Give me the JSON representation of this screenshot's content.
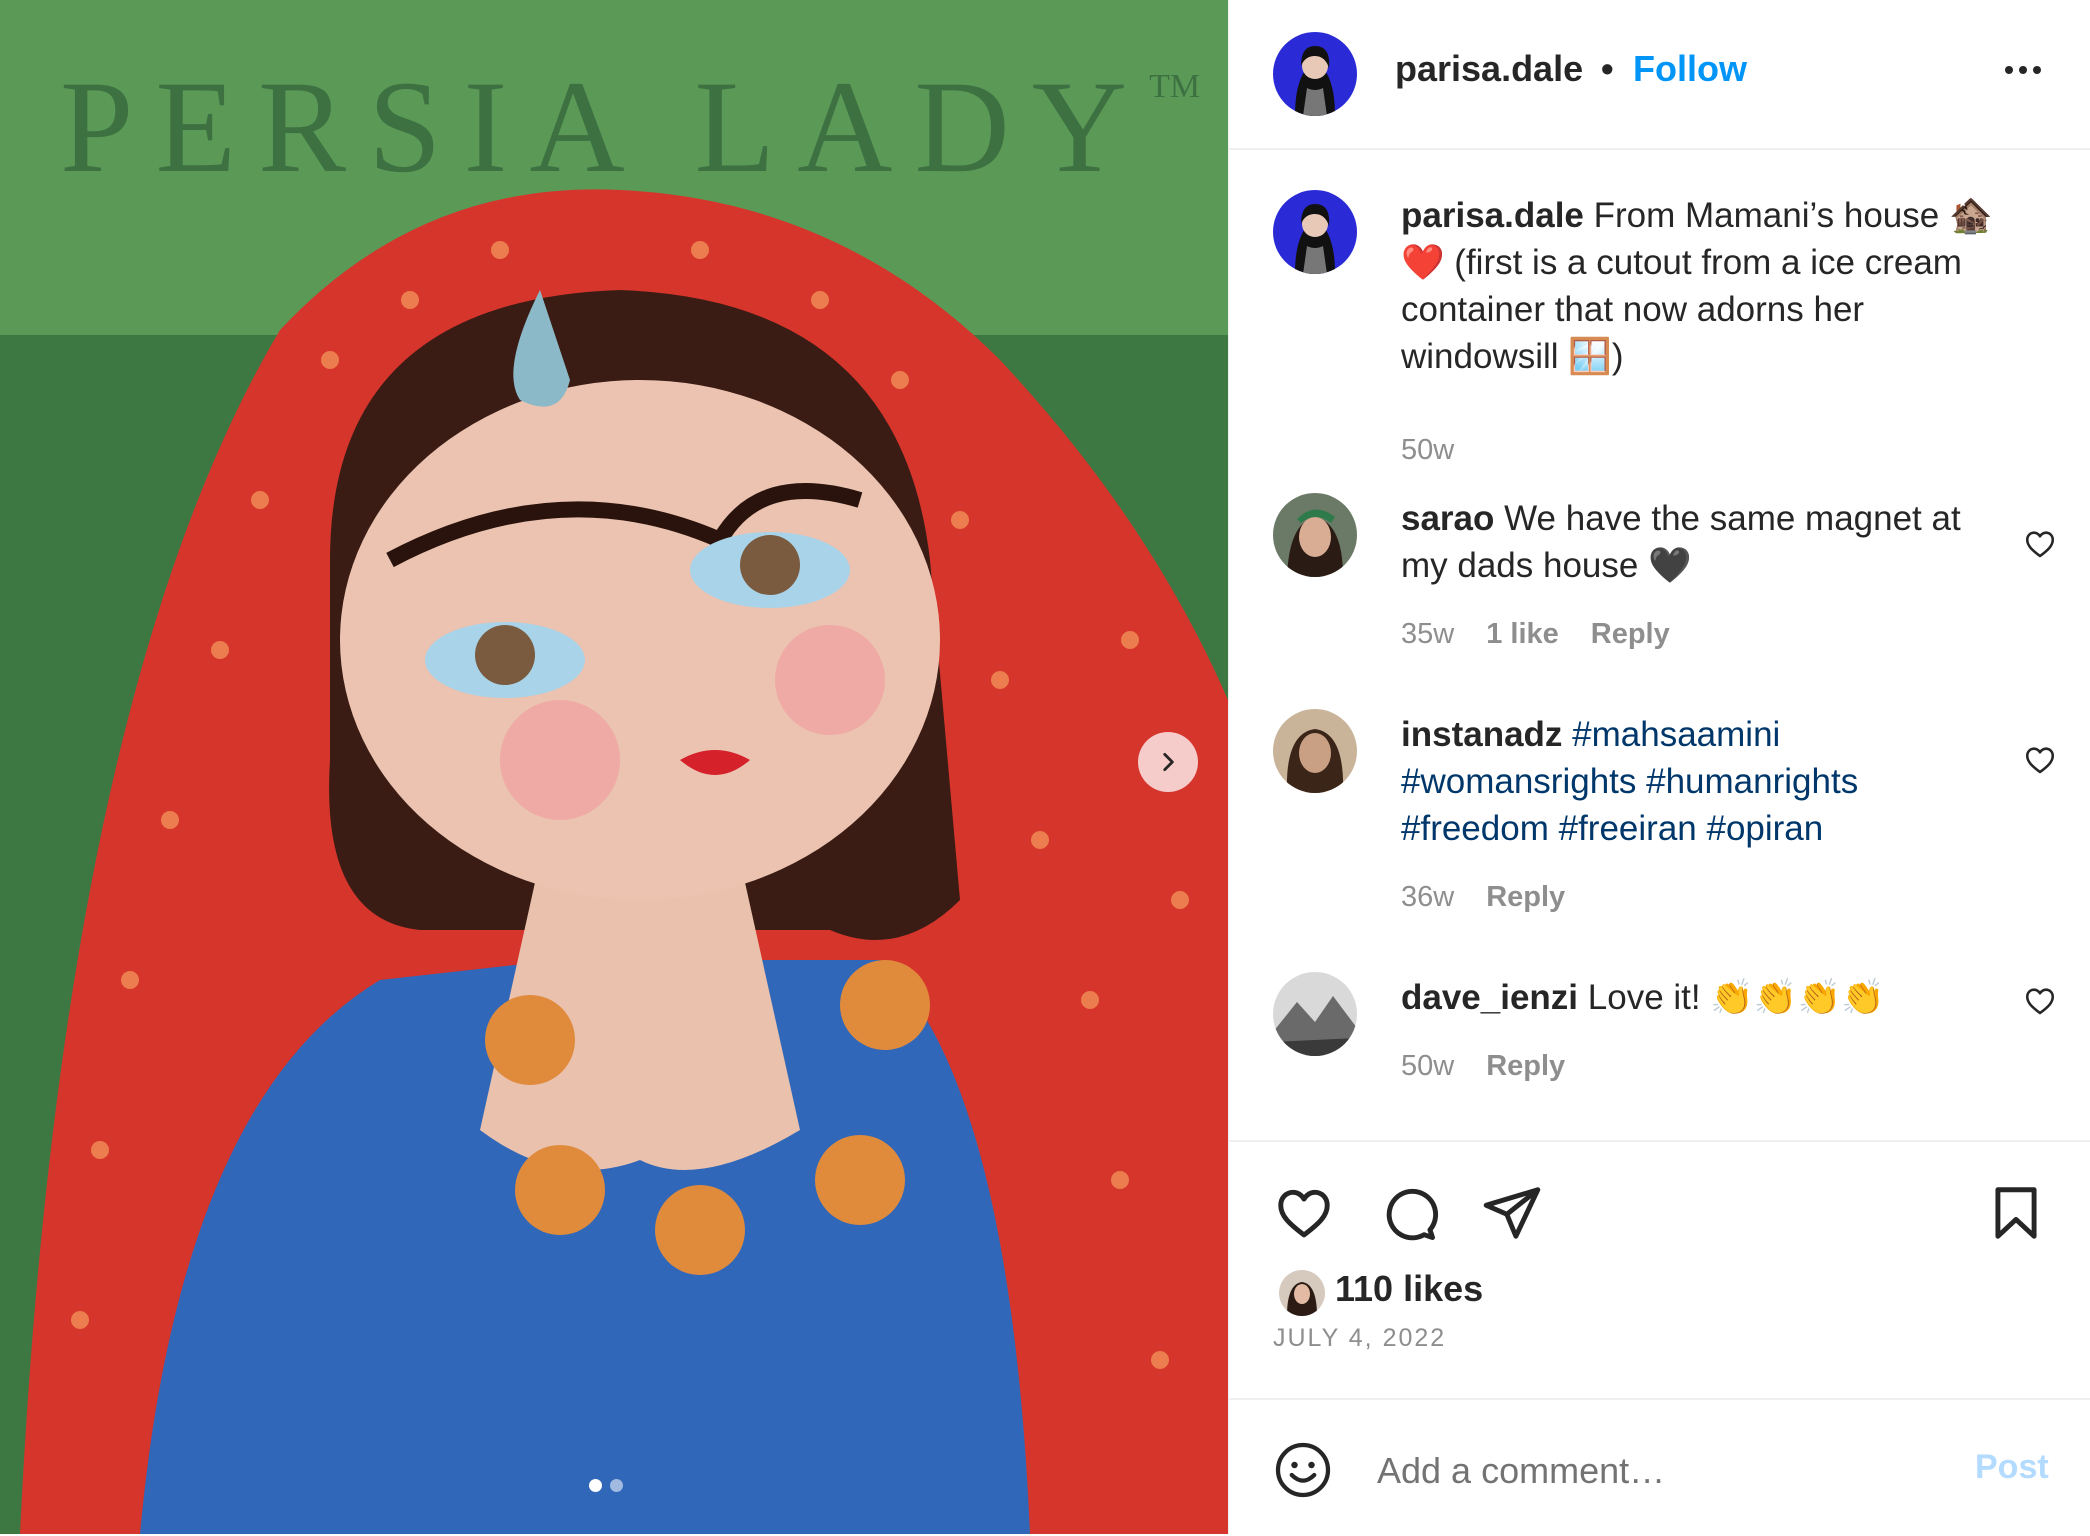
{
  "media": {
    "brand_text": "PERSIA LADY",
    "brand_mark": "TM",
    "carousel_dots": 2,
    "active_dot": 0
  },
  "header": {
    "username": "parisa.dale",
    "separator": "•",
    "follow_label": "Follow",
    "more_icon": "more-horizontal-icon"
  },
  "caption": {
    "username": "parisa.dale",
    "text": "From Mamani’s house 🏚️❤️ (first is a cutout from a ice cream container that now adorns her windowsill 🪟)",
    "age": "50w"
  },
  "comments": [
    {
      "username": "sarao",
      "text": "We have the same magnet at my dads house 🖤",
      "age": "35w",
      "likes": "1 like",
      "reply": "Reply"
    },
    {
      "username": "instanadz",
      "hashtags": [
        "#mahsaamini",
        "#womansrights",
        "#humanrights",
        "#freedom",
        "#freeiran",
        "#opiran"
      ],
      "age": "36w",
      "reply": "Reply"
    },
    {
      "username": "dave_ienzi",
      "text": "Love it! 👏👏👏👏",
      "age": "50w",
      "reply": "Reply"
    }
  ],
  "actions": {
    "likes": "110 likes",
    "date": "JULY 4, 2022"
  },
  "comment_box": {
    "placeholder": "Add a comment…",
    "post_label": "Post"
  },
  "colors": {
    "link_blue": "#0095f6",
    "hashtag_blue": "#00376b",
    "muted_gray": "#8e8e8e",
    "post_disabled": "#b3dbff"
  }
}
